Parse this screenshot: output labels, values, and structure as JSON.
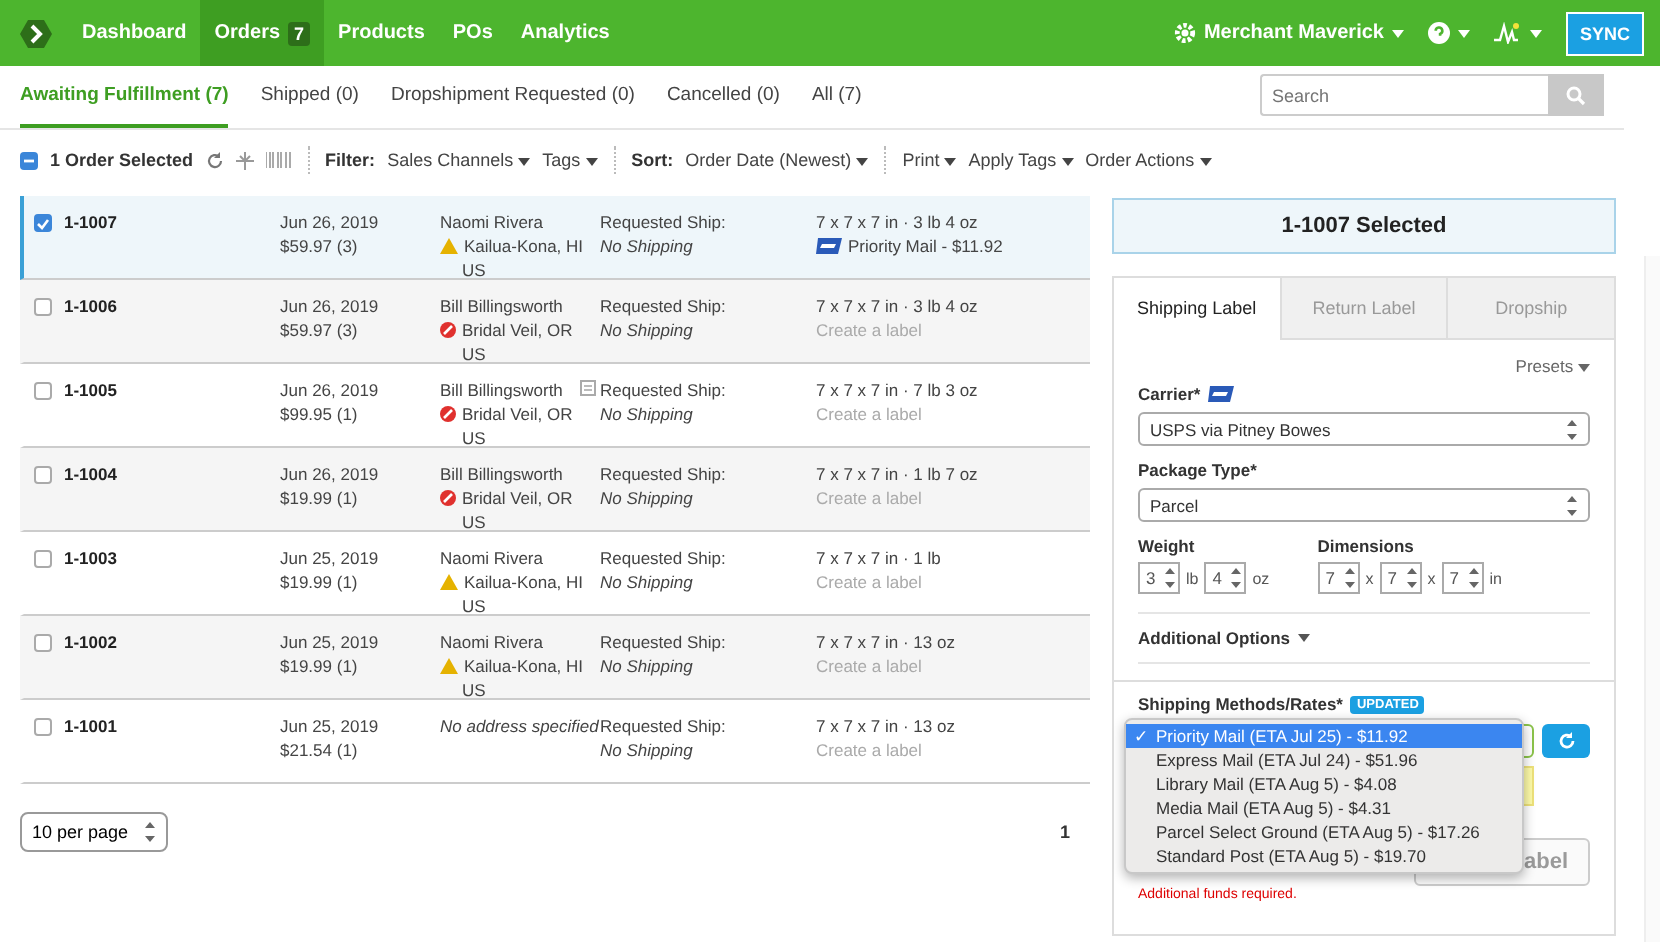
{
  "nav": {
    "items": [
      {
        "label": "Dashboard",
        "selected": false
      },
      {
        "label": "Orders",
        "badge": "7",
        "selected": true
      },
      {
        "label": "Products",
        "selected": false
      },
      {
        "label": "POs",
        "selected": false
      },
      {
        "label": "Analytics",
        "selected": false
      }
    ],
    "account": "Merchant Maverick",
    "sync": "SYNC"
  },
  "tabs": [
    {
      "label": "Awaiting Fulfillment (7)",
      "selected": true
    },
    {
      "label": "Shipped (0)",
      "selected": false
    },
    {
      "label": "Dropshipment Requested (0)",
      "selected": false
    },
    {
      "label": "Cancelled (0)",
      "selected": false
    },
    {
      "label": "All (7)",
      "selected": false
    }
  ],
  "search": {
    "placeholder": "Search"
  },
  "toolbar": {
    "selection": "1 Order Selected",
    "filter_label": "Filter:",
    "filters": [
      "Sales Channels",
      "Tags"
    ],
    "sort_label": "Sort:",
    "sort": "Order Date (Newest)",
    "actions": [
      "Print",
      "Apply Tags",
      "Order Actions"
    ]
  },
  "orders": [
    {
      "id": "1-1007",
      "date": "Jun 26, 2019",
      "total": "$59.97 (3)",
      "name": "Naomi Rivera",
      "city": "Kailua-Kona, HI",
      "country": "US",
      "address_error": false,
      "note": false,
      "ship_label": "Requested Ship:",
      "ship": "No Shipping",
      "dims": "7 x 7 x 7 in · 3 lb 4 oz",
      "label": "Priority Mail - $11.92",
      "label_purchased": true,
      "selected": true
    },
    {
      "id": "1-1006",
      "date": "Jun 26, 2019",
      "total": "$59.97 (3)",
      "name": "Bill Billingsworth",
      "city": "Bridal Veil, OR",
      "country": "US",
      "address_error": true,
      "note": false,
      "ship_label": "Requested Ship:",
      "ship": "No Shipping",
      "dims": "7 x 7 x 7 in · 3 lb 4 oz",
      "label": "Create a label",
      "label_purchased": false,
      "selected": false
    },
    {
      "id": "1-1005",
      "date": "Jun 26, 2019",
      "total": "$99.95 (1)",
      "name": "Bill Billingsworth",
      "city": "Bridal Veil, OR",
      "country": "US",
      "address_error": true,
      "note": true,
      "ship_label": "Requested Ship:",
      "ship": "No Shipping",
      "dims": "7 x 7 x 7 in · 7 lb 3 oz",
      "label": "Create a label",
      "label_purchased": false,
      "selected": false
    },
    {
      "id": "1-1004",
      "date": "Jun 26, 2019",
      "total": "$19.99 (1)",
      "name": "Bill Billingsworth",
      "city": "Bridal Veil, OR",
      "country": "US",
      "address_error": true,
      "note": false,
      "ship_label": "Requested Ship:",
      "ship": "No Shipping",
      "dims": "7 x 7 x 7 in · 1 lb 7 oz",
      "label": "Create a label",
      "label_purchased": false,
      "selected": false
    },
    {
      "id": "1-1003",
      "date": "Jun 25, 2019",
      "total": "$19.99 (1)",
      "name": "Naomi Rivera",
      "city": "Kailua-Kona, HI",
      "country": "US",
      "address_error": false,
      "note": false,
      "ship_label": "Requested Ship:",
      "ship": "No Shipping",
      "dims": "7 x 7 x 7 in · 1 lb",
      "label": "Create a label",
      "label_purchased": false,
      "selected": false
    },
    {
      "id": "1-1002",
      "date": "Jun 25, 2019",
      "total": "$19.99 (1)",
      "name": "Naomi Rivera",
      "city": "Kailua-Kona, HI",
      "country": "US",
      "address_error": false,
      "note": false,
      "ship_label": "Requested Ship:",
      "ship": "No Shipping",
      "dims": "7 x 7 x 7 in · 13 oz",
      "label": "Create a label",
      "label_purchased": false,
      "selected": false
    },
    {
      "id": "1-1001",
      "date": "Jun 25, 2019",
      "total": "$21.54 (1)",
      "name": "No address specified",
      "note": false,
      "ship_label": "Requested Ship:",
      "ship": "No Shipping",
      "dims": "7 x 7 x 7 in · 13 oz",
      "label": "Create a label",
      "label_purchased": false,
      "selected": false
    }
  ],
  "pagination": {
    "per_page": "10 per page",
    "page": "1"
  },
  "panel": {
    "title": "1-1007 Selected",
    "tabs": [
      {
        "label": "Shipping Label",
        "selected": true
      },
      {
        "label": "Return Label",
        "selected": false
      },
      {
        "label": "Dropship",
        "selected": false
      }
    ],
    "presets": "Presets",
    "carrier_label": "Carrier*",
    "carrier": "USPS via Pitney Bowes",
    "package_label": "Package Type*",
    "package": "Parcel",
    "weight_label": "Weight",
    "weight_lb": "3",
    "lb": "lb",
    "weight_oz": "4",
    "oz": "oz",
    "dimensions_label": "Dimensions",
    "dims": [
      {
        "value": "7",
        "unit": "x"
      },
      {
        "value": "7",
        "unit": "x"
      },
      {
        "value": "7",
        "unit": "in"
      }
    ],
    "additional": "Additional Options",
    "rates_label": "Shipping Methods/Rates*",
    "rates_badge": "UPDATED",
    "rates": [
      {
        "label": "Priority Mail (ETA Jul 25) - $11.92",
        "selected": true
      },
      {
        "label": "Express Mail (ETA Jul 24) - $51.96",
        "selected": false
      },
      {
        "label": "Library Mail (ETA Aug 5) - $4.08",
        "selected": false
      },
      {
        "label": "Media Mail (ETA Aug 5) - $4.31",
        "selected": false
      },
      {
        "label": "Parcel Select Ground (ETA Aug 5) - $17.26",
        "selected": false
      },
      {
        "label": "Standard Post (ETA Aug 5) - $19.70",
        "selected": false
      }
    ],
    "check": "✓",
    "create_button": "abel",
    "funds_error": "Additional funds required."
  }
}
